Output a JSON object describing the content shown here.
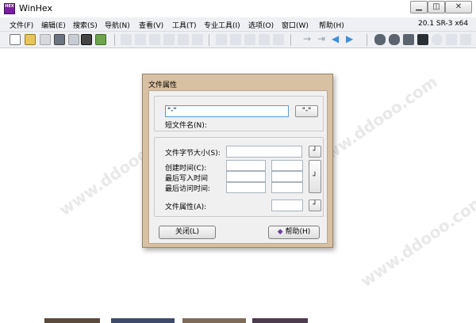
{
  "window": {
    "title": "WinHex",
    "app_icon_text": "HEX"
  },
  "menu": {
    "items": [
      {
        "label": "文件(F)"
      },
      {
        "label": "编辑(E)"
      },
      {
        "label": "搜索(S)"
      },
      {
        "label": "导航(N)"
      },
      {
        "label": "查看(V)"
      },
      {
        "label": "工具(T)"
      },
      {
        "label": "专业工具(I)"
      },
      {
        "label": "选项(O)"
      },
      {
        "label": "窗口(W)"
      },
      {
        "label": "帮助(H)"
      }
    ],
    "version": "20.1 SR-3 x64"
  },
  "watermark": {
    "text": "www.ddooo.com"
  },
  "dialog": {
    "title": "文件属性",
    "filename_value": "\"-\"",
    "short_name_label": "短文件名(N):",
    "browse_button": "\"-\"",
    "size_label": "文件字节大小(S):",
    "created_label": "创建时间(C):",
    "last_write_label": "最后写入时间",
    "last_access_label": "最后访问时间:",
    "attributes_label": "文件属性(A):",
    "apply_glyph": "┘",
    "close_button": "关闭(L)",
    "help_button": "帮助(H)"
  },
  "colors": {
    "dialog_frame": "#d8c0a2",
    "menubar_bg": "#eef0f4",
    "toolbar_blue": "#3c8fd9",
    "toolbar_purple": "#6a3fa0"
  }
}
